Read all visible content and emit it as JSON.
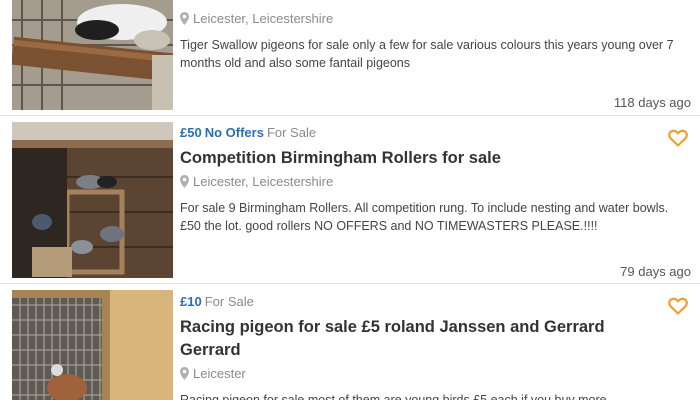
{
  "listings": [
    {
      "location": "Leicester, Leicestershire",
      "description": "Tiger Swallow pigeons for sale only a few for sale various colours this years young over 7 months old and also some fantail pigeons",
      "age": "118 days ago",
      "thumb_icon": "pigeon-photo"
    },
    {
      "price": "£50",
      "tag": "No Offers",
      "sale_type": "For Sale",
      "title": "Competition Birmingham Rollers for sale",
      "location": "Leicester, Leicestershire",
      "description": "For sale 9 Birmingham Rollers. All competition rung. To include nesting and water bowls. £50 the lot. good rollers NO OFFERS and NO TIMEWASTERS PLEASE.!!!!",
      "age": "79 days ago",
      "thumb_icon": "pigeon-loft-photo",
      "favourite_icon": "heart-outline-icon"
    },
    {
      "price": "£10",
      "sale_type": "For Sale",
      "title": "Racing pigeon for sale £5 roland Janssen and Gerrard Gerrard",
      "location": "Leicester",
      "description": "Racing pigeon for sale most of them are young birds £5 each if you buy more",
      "thumb_icon": "pigeon-cage-photo",
      "favourite_icon": "heart-outline-icon"
    }
  ],
  "colors": {
    "accent_blue": "#2a6ebb",
    "heart_orange": "#f0a030",
    "muted_grey": "#8a8a8a"
  }
}
